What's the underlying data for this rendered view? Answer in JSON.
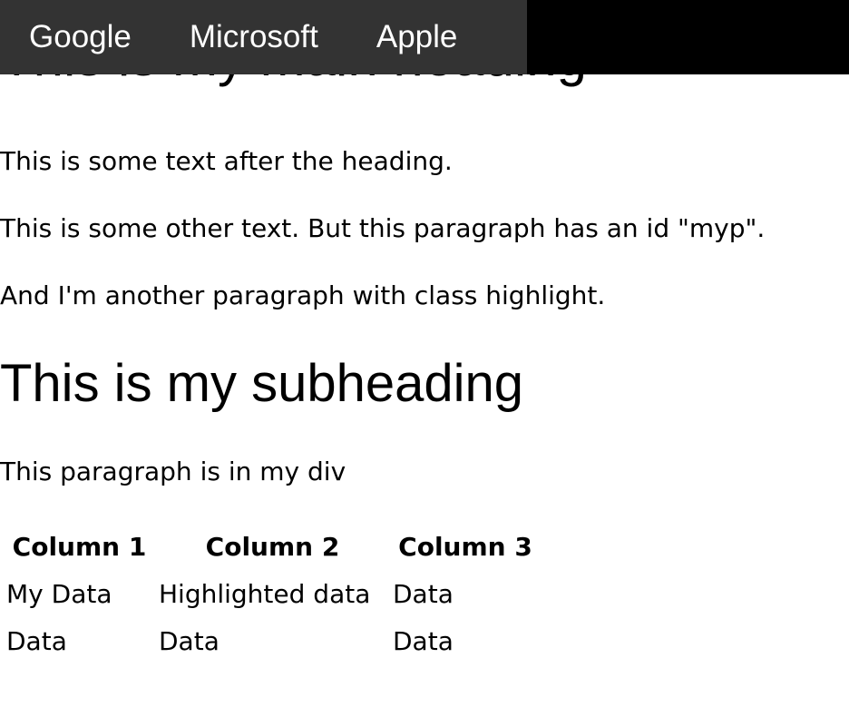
{
  "nav": {
    "links": [
      {
        "label": "Google"
      },
      {
        "label": "Microsoft"
      },
      {
        "label": "Apple"
      }
    ]
  },
  "main_heading": "This is my main heading",
  "paragraphs": {
    "intro": "This is some text after the heading.",
    "myp": "This is some other text. But this paragraph has an id \"myp\".",
    "highlight": "And I'm another paragraph with class highlight."
  },
  "sub_heading": "This is my subheading",
  "div_paragraph": "This paragraph is in my div",
  "table": {
    "headers": [
      "Column 1",
      "Column 2",
      "Column 3"
    ],
    "rows": [
      [
        "My Data",
        "Highlighted data",
        "Data"
      ],
      [
        "Data",
        "Data",
        "Data"
      ]
    ]
  },
  "colors": {
    "nav_background": "#333333",
    "bar_background": "#000000",
    "nav_text": "#ffffff"
  }
}
